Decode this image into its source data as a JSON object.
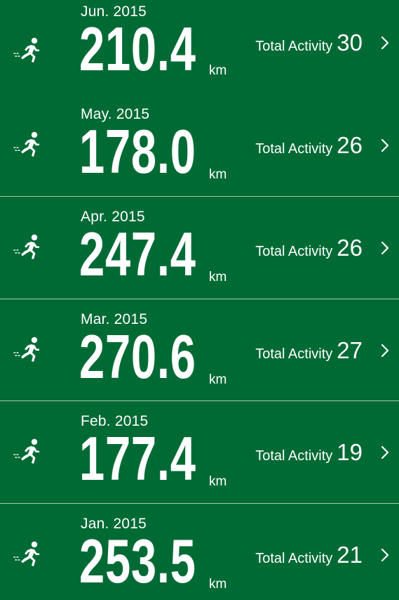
{
  "rows": [
    {
      "month": "Jun. 2015",
      "distance": "210.4",
      "unit": "km",
      "activity_label": "Total Activity",
      "activity_count": "30"
    },
    {
      "month": "May. 2015",
      "distance": "178.0",
      "unit": "km",
      "activity_label": "Total Activity",
      "activity_count": "26"
    },
    {
      "month": "Apr. 2015",
      "distance": "247.4",
      "unit": "km",
      "activity_label": "Total Activity",
      "activity_count": "26"
    },
    {
      "month": "Mar. 2015",
      "distance": "270.6",
      "unit": "km",
      "activity_label": "Total Activity",
      "activity_count": "27"
    },
    {
      "month": "Feb. 2015",
      "distance": "177.4",
      "unit": "km",
      "activity_label": "Total Activity",
      "activity_count": "19"
    },
    {
      "month": "Jan. 2015",
      "distance": "253.5",
      "unit": "km",
      "activity_label": "Total Activity",
      "activity_count": "21"
    }
  ],
  "icons": {
    "row_icon": "runner-icon",
    "row_disclosure": "chevron-right-icon"
  },
  "colors": {
    "background": "#006A35",
    "text": "#FFFFFF",
    "separator": "#A9C9B2"
  }
}
